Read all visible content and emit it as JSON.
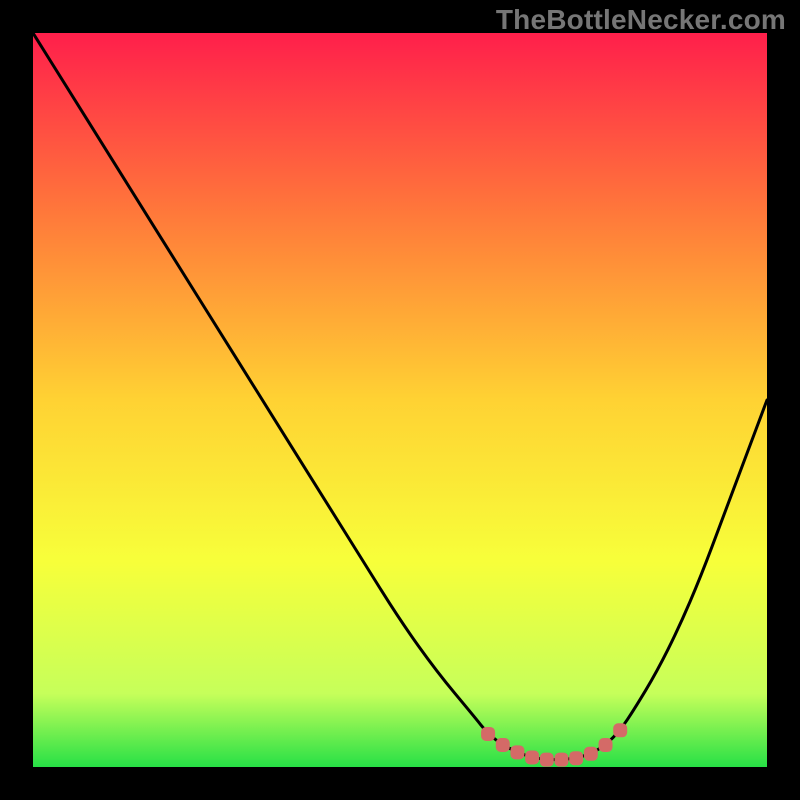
{
  "watermark": "TheBottleNecker.com",
  "colors": {
    "bg": "#000000",
    "gradient_top": "#ff1f4b",
    "gradient_mid_upper": "#ff7a3a",
    "gradient_mid": "#ffd233",
    "gradient_mid_lower": "#f7ff3a",
    "gradient_lower": "#c6ff5a",
    "gradient_bottom": "#27e046",
    "curve": "#000000",
    "marker": "#d46a67",
    "watermark": "#767676"
  },
  "chart_data": {
    "type": "line",
    "title": "",
    "xlabel": "",
    "ylabel": "",
    "xlim": [
      0,
      100
    ],
    "ylim": [
      0,
      100
    ],
    "x": [
      0,
      5,
      10,
      15,
      20,
      25,
      30,
      35,
      40,
      45,
      50,
      55,
      60,
      62,
      64,
      66,
      68,
      70,
      72,
      74,
      76,
      78,
      80,
      82,
      85,
      88,
      91,
      94,
      97,
      100
    ],
    "values": [
      100,
      92,
      84,
      76,
      68,
      60,
      52,
      44,
      36,
      28,
      20,
      13,
      7,
      4.5,
      3,
      2,
      1.3,
      1,
      1,
      1.2,
      1.8,
      3,
      5,
      8,
      13,
      19,
      26,
      34,
      42,
      50
    ],
    "markers_x": [
      62,
      64,
      66,
      68,
      70,
      72,
      74,
      76,
      78,
      80
    ],
    "markers_y": [
      4.5,
      3,
      2,
      1.3,
      1,
      1,
      1.2,
      1.8,
      3,
      5
    ],
    "annotations": []
  }
}
